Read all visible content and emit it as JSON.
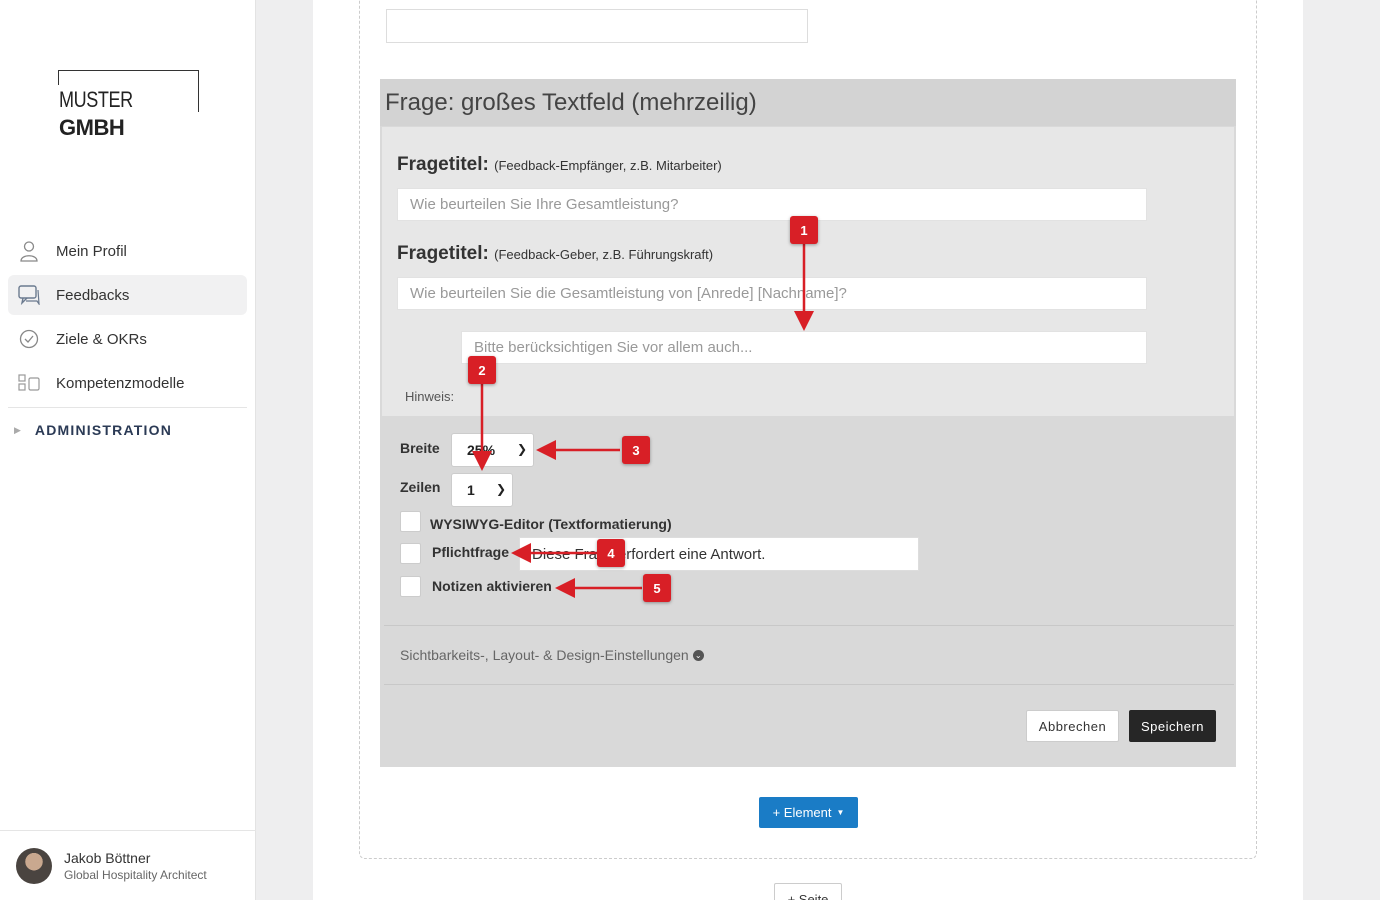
{
  "sidebar": {
    "logo": {
      "part1": "MUSTER",
      "part2": "GMBH"
    },
    "items": [
      {
        "label": "Mein Profil",
        "icon": "user-icon"
      },
      {
        "label": "Feedbacks",
        "icon": "chat-icon",
        "active": true
      },
      {
        "label": "Ziele & OKRs",
        "icon": "check-circle-icon"
      },
      {
        "label": "Kompetenzmodelle",
        "icon": "blocks-icon"
      }
    ],
    "admin_label": "ADMINISTRATION",
    "user": {
      "name": "Jakob Böttner",
      "role": "Global Hospitality Architect"
    }
  },
  "card": {
    "title": "Frage: großes Textfeld (mehrzeilig)",
    "q1_label": "Fragetitel:",
    "q1_sub": "(Feedback-Empfänger, z.B. Mitarbeiter)",
    "q1_placeholder": "Wie beurteilen Sie Ihre Gesamtleistung?",
    "q2_label": "Fragetitel:",
    "q2_sub": "(Feedback-Geber, z.B. Führungskraft)",
    "q2_placeholder": "Wie beurteilen Sie die Gesamtleistung von [Anrede] [Nachname]?",
    "hint_label": "Hinweis:",
    "hint_placeholder": "Bitte berücksichtigen Sie vor allem auch...",
    "width_label": "Breite",
    "width_value": "25%",
    "rows_label": "Zeilen",
    "rows_value": "1",
    "wysiwyg_label": "WYSIWYG-Editor (Textformatierung)",
    "required_label": "Pflichtfrage",
    "required_text": "Diese Frage erfordert eine Antwort.",
    "notes_label": "Notizen aktivieren",
    "settings_link": "Sichtbarkeits-, Layout- & Design-Einstellungen",
    "cancel": "Abbrechen",
    "save": "Speichern"
  },
  "add_element": "+ Element",
  "add_page": "+ Seite",
  "annotations": [
    "1",
    "2",
    "3",
    "4",
    "5"
  ],
  "colors": {
    "accent": "#1a7cc6",
    "annotation": "#d81f26",
    "save_button": "#262626"
  }
}
